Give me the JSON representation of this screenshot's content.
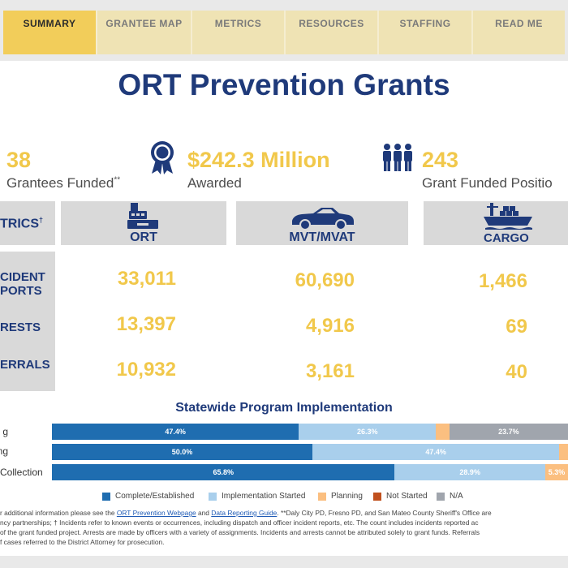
{
  "tabs": [
    {
      "label": "SUMMARY",
      "active": true
    },
    {
      "label": "GRANTEE MAP",
      "active": false
    },
    {
      "label": "METRICS",
      "active": false
    },
    {
      "label": "RESOURCES",
      "active": false
    },
    {
      "label": "STAFFING",
      "active": false
    },
    {
      "label": "READ ME",
      "active": false
    }
  ],
  "title": "ORT Prevention Grants",
  "kpis": {
    "grantees": {
      "value": "38",
      "label": "Grantees Funded",
      "mark": "**"
    },
    "awarded": {
      "value": "$242.3 Million",
      "label": "Awarded",
      "icon": "award-ribbon-icon"
    },
    "positions": {
      "value": "243",
      "label": "Grant Funded Positio",
      "icon": "people-group-icon"
    }
  },
  "metrics": {
    "header_label": "TRICS",
    "header_mark": "†",
    "columns": [
      {
        "label": "ORT",
        "icon": "cash-register-icon"
      },
      {
        "label": "MVT/MVAT",
        "icon": "car-icon"
      },
      {
        "label": "CARGO",
        "icon": "cargo-ship-icon"
      }
    ],
    "rows": [
      {
        "label": "CIDENT\nPORTS",
        "values": [
          "33,011",
          "60,690",
          "1,466"
        ]
      },
      {
        "label": "RESTS",
        "values": [
          "13,397",
          "4,916",
          "69"
        ]
      },
      {
        "label": "ERRALS",
        "values": [
          "10,932",
          "3,161",
          "40"
        ]
      }
    ]
  },
  "implementation": {
    "title": "Statewide Program Implementation",
    "bars": [
      {
        "label": "g",
        "segments": [
          {
            "status": "Complete/Established",
            "percent": 47.4,
            "text": "47.4%"
          },
          {
            "status": "Implementation Started",
            "percent": 26.3,
            "text": "26.3%"
          },
          {
            "status": "Planning",
            "percent": 2.6,
            "text": ""
          },
          {
            "status": "N/A",
            "percent": 23.7,
            "text": "23.7%"
          }
        ]
      },
      {
        "label": "ing",
        "segments": [
          {
            "status": "Complete/Established",
            "percent": 50.0,
            "text": "50.0%"
          },
          {
            "status": "Implementation Started",
            "percent": 47.4,
            "text": "47.4%"
          },
          {
            "status": "Planning",
            "percent": 2.6,
            "text": ""
          }
        ]
      },
      {
        "label": "Collection",
        "segments": [
          {
            "status": "Complete/Established",
            "percent": 65.8,
            "text": "65.8%"
          },
          {
            "status": "Implementation Started",
            "percent": 28.9,
            "text": "28.9%"
          },
          {
            "status": "Planning",
            "percent": 5.3,
            "text": "5.3%"
          }
        ]
      }
    ],
    "legend": [
      {
        "label": "Complete/Established",
        "color": "#1f6db0"
      },
      {
        "label": "Implementation Started",
        "color": "#a9cfec"
      },
      {
        "label": "Planning",
        "color": "#fbbf80"
      },
      {
        "label": "Not Started",
        "color": "#c0501e"
      },
      {
        "label": "N/A",
        "color": "#a0a5ad"
      }
    ]
  },
  "footnote": {
    "line1_a": "r additional information please see the ",
    "link1": "ORT Prevention Webpage",
    "line1_b": " and ",
    "link2": "Data Reporting Guide",
    "line1_c": ". **Daly City PD, Fresno PD, and San Mateo County Sheriff's Office are",
    "line2": "ncy partnerships; † Incidents refer to known events or occurrences, including dispatch and officer incident reports, etc. The count includes incidents reported ac",
    "line3": " of the grant funded project. Arrests are made by officers with a variety of assignments. Incidents and arrests cannot be attributed solely to grant funds. Referrals",
    "line4": "f cases referred to the District Attorney for prosecution."
  }
}
